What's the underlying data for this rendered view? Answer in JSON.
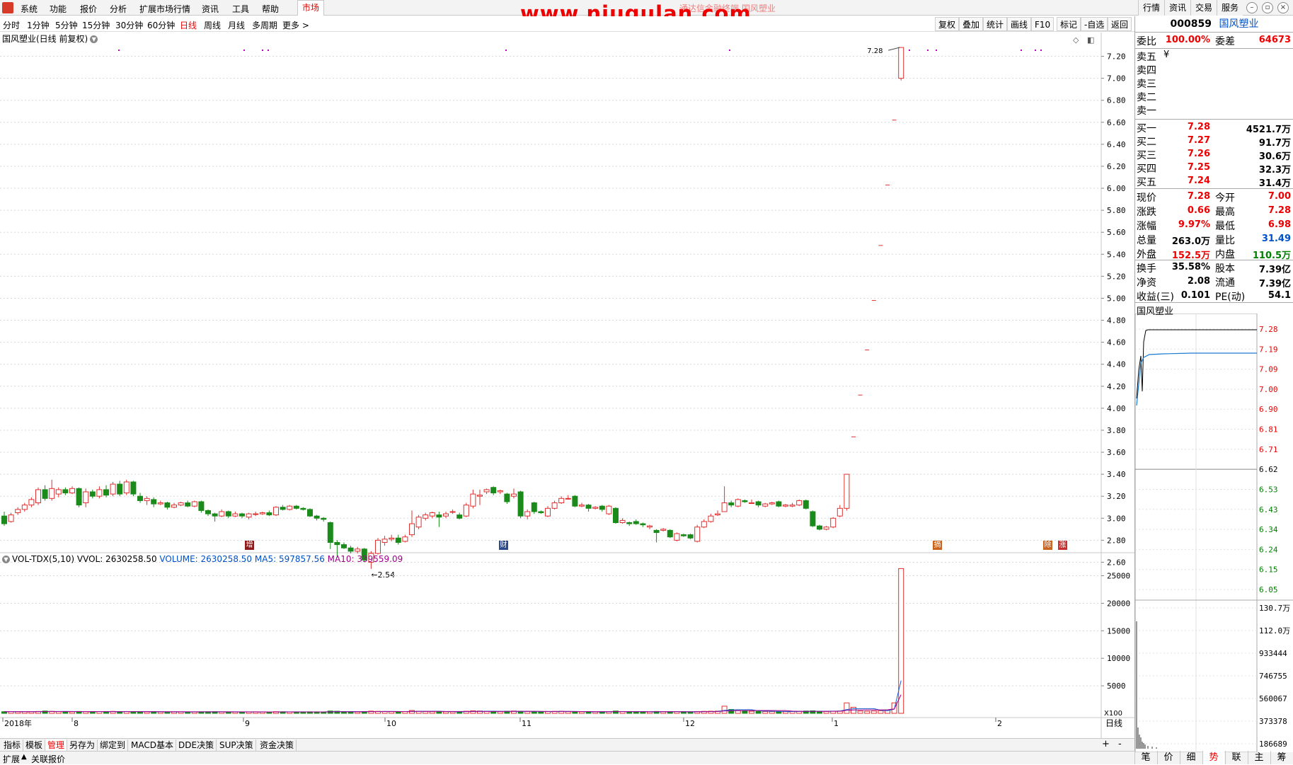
{
  "menubar": {
    "items": [
      "系统",
      "功能",
      "报价",
      "分析",
      "扩展市场行情",
      "资讯",
      "工具",
      "帮助"
    ],
    "market": "市场",
    "watermark": "www.niugulan.com",
    "watermark_under": "通达信金融终端 国风塑业",
    "right_buttons": [
      "行情",
      "资讯",
      "交易",
      "服务"
    ]
  },
  "periods": [
    "分时",
    "1分钟",
    "5分钟",
    "15分钟",
    "30分钟",
    "60分钟",
    "日线",
    "周线",
    "月线",
    "多周期",
    "更多 >"
  ],
  "active_period": "日线",
  "tools": [
    "复权",
    "叠加",
    "统计",
    "画线",
    "F10",
    "标记",
    "-自选",
    "返回"
  ],
  "chart_title": "国风塑业(日线 前复权)",
  "vol_title": {
    "name": "VOL-TDX(5,10)",
    "vvol": "VVOL: 2630258.50",
    "volume": "VOLUME: 2630258.50",
    "ma5": "MA5: 597857.56",
    "ma10": "MA10: 339559.09"
  },
  "price_axis": [
    "7.20",
    "7.00",
    "6.80",
    "6.60",
    "6.40",
    "6.20",
    "6.00",
    "5.80",
    "5.60",
    "5.40",
    "5.20",
    "5.00",
    "4.80",
    "4.60",
    "4.40",
    "4.20",
    "4.00",
    "3.80",
    "3.60",
    "3.40",
    "3.20",
    "3.00",
    "2.80",
    "2.60"
  ],
  "vol_axis": [
    "25000",
    "20000",
    "15000",
    "10000",
    "5000"
  ],
  "vol_unit": "X100",
  "date_axis": [
    {
      "label": "2018年",
      "x": 4
    },
    {
      "label": "8",
      "x": 102
    },
    {
      "label": "9",
      "x": 344
    },
    {
      "label": "10",
      "x": 544
    },
    {
      "label": "11",
      "x": 735
    },
    {
      "label": "12",
      "x": 966
    },
    {
      "label": "1",
      "x": 1176
    },
    {
      "label": "2",
      "x": 1407
    }
  ],
  "date_mode": "日线",
  "annotations": {
    "high": "7.28",
    "low": "2.54"
  },
  "markers": [
    "增",
    "财",
    "摘",
    "除",
    "涨"
  ],
  "quote": {
    "code": "000859",
    "name": "国风塑业",
    "weibi_label": "委比",
    "weibi": "100.00%",
    "weicha_label": "委差",
    "weicha": "64673",
    "sell": [
      {
        "label": "卖五",
        "price": "¥",
        "vol": ""
      },
      {
        "label": "卖四",
        "price": "",
        "vol": ""
      },
      {
        "label": "卖三",
        "price": "",
        "vol": ""
      },
      {
        "label": "卖二",
        "price": "",
        "vol": ""
      },
      {
        "label": "卖一",
        "price": "",
        "vol": ""
      }
    ],
    "buy": [
      {
        "label": "买一",
        "price": "7.28",
        "vol": "4521.7万"
      },
      {
        "label": "买二",
        "price": "7.27",
        "vol": "91.7万"
      },
      {
        "label": "买三",
        "price": "7.26",
        "vol": "30.6万"
      },
      {
        "label": "买四",
        "price": "7.25",
        "vol": "32.3万"
      },
      {
        "label": "买五",
        "price": "7.24",
        "vol": "31.4万"
      }
    ],
    "stats": [
      {
        "l": "现价",
        "v": "7.28",
        "vc": "red",
        "l2": "今开",
        "v2": "7.00",
        "v2c": "red"
      },
      {
        "l": "涨跌",
        "v": "0.66",
        "vc": "red",
        "l2": "最高",
        "v2": "7.28",
        "v2c": "red"
      },
      {
        "l": "涨幅",
        "v": "9.97%",
        "vc": "red",
        "l2": "最低",
        "v2": "6.98",
        "v2c": "red"
      },
      {
        "l": "总量",
        "v": "263.0万",
        "vc": "black",
        "l2": "量比",
        "v2": "31.49",
        "v2c": "blue"
      },
      {
        "l": "外盘",
        "v": "152.5万",
        "vc": "red",
        "l2": "内盘",
        "v2": "110.5万",
        "v2c": "green"
      },
      {
        "l": "换手",
        "v": "35.58%",
        "vc": "black",
        "l2": "股本",
        "v2": "7.39亿",
        "v2c": "black"
      },
      {
        "l": "净资",
        "v": "2.08",
        "vc": "black",
        "l2": "流通",
        "v2": "7.39亿",
        "v2c": "black"
      },
      {
        "l": "收益(三)",
        "v": "0.101",
        "vc": "black",
        "l2": "PE(动)",
        "v2": "54.1",
        "v2c": "black"
      }
    ],
    "mini_title": "国风塑业",
    "mini_price_axis": [
      "7.28",
      "7.19",
      "7.09",
      "7.00",
      "6.90",
      "6.81",
      "6.71",
      "6.62",
      "6.53",
      "6.43",
      "6.34",
      "6.24",
      "6.15",
      "6.05"
    ],
    "mini_vol_axis": [
      "130.7万",
      "112.0万",
      "933444",
      "746755",
      "560067",
      "373378",
      "186689"
    ]
  },
  "bottom_tabs": [
    "指标",
    "模板",
    "管理",
    "另存为",
    "绑定到",
    "MACD基本",
    "DDE决策",
    "SUP决策",
    "资金决策"
  ],
  "active_bottom_tab": "管理",
  "date_label": "日线",
  "status_tabs": [
    "扩展",
    "关联报价"
  ],
  "right_tabs": [
    "笔",
    "价",
    "细",
    "势",
    "联",
    "主",
    "筹"
  ],
  "active_right_tab": "势",
  "chart_data": {
    "type": "candlestick",
    "ylim": [
      2.5,
      7.3
    ],
    "candles": [
      [
        3.02,
        2.95,
        3.06,
        2.93
      ],
      [
        2.97,
        3.03,
        3.05,
        2.96
      ],
      [
        3.05,
        3.08,
        3.1,
        3.03
      ],
      [
        3.08,
        3.12,
        3.14,
        3.06
      ],
      [
        3.12,
        3.17,
        3.19,
        3.1
      ],
      [
        3.14,
        3.26,
        3.28,
        3.12
      ],
      [
        3.26,
        3.18,
        3.3,
        3.16
      ],
      [
        3.18,
        3.27,
        3.35,
        3.16
      ],
      [
        3.22,
        3.26,
        3.28,
        3.19
      ],
      [
        3.26,
        3.23,
        3.28,
        3.21
      ],
      [
        3.23,
        3.27,
        3.29,
        3.22
      ],
      [
        3.27,
        3.12,
        3.28,
        3.1
      ],
      [
        3.14,
        3.24,
        3.27,
        3.1
      ],
      [
        3.24,
        3.2,
        3.26,
        3.18
      ],
      [
        3.2,
        3.26,
        3.29,
        3.18
      ],
      [
        3.26,
        3.21,
        3.3,
        3.19
      ],
      [
        3.22,
        3.31,
        3.33,
        3.2
      ],
      [
        3.31,
        3.22,
        3.34,
        3.2
      ],
      [
        3.23,
        3.33,
        3.35,
        3.21
      ],
      [
        3.33,
        3.22,
        3.34,
        3.2
      ],
      [
        3.2,
        3.16,
        3.23,
        3.14
      ],
      [
        3.16,
        3.18,
        3.2,
        3.12
      ],
      [
        3.17,
        3.13,
        3.19,
        3.1
      ],
      [
        3.13,
        3.14,
        3.16,
        3.12
      ],
      [
        3.14,
        3.1,
        3.15,
        3.08
      ],
      [
        3.1,
        3.12,
        3.14,
        3.09
      ],
      [
        3.12,
        3.14,
        3.15,
        3.11
      ],
      [
        3.14,
        3.11,
        3.16,
        3.1
      ],
      [
        3.11,
        3.15,
        3.16,
        3.1
      ],
      [
        3.15,
        3.07,
        3.16,
        3.05
      ],
      [
        3.07,
        3.04,
        3.08,
        3.02
      ],
      [
        3.04,
        3.02,
        3.05,
        2.97
      ],
      [
        3.02,
        3.06,
        3.08,
        3.01
      ],
      [
        3.06,
        3.02,
        3.07,
        3.0
      ],
      [
        3.02,
        3.04,
        3.06,
        3.01
      ],
      [
        3.04,
        3.02,
        3.05,
        3.0
      ],
      [
        3.01,
        3.04,
        3.05,
        2.99
      ],
      [
        3.04,
        3.04,
        3.06,
        3.02
      ],
      [
        3.04,
        3.05,
        3.06,
        3.03
      ],
      [
        3.05,
        3.03,
        3.07,
        3.02
      ],
      [
        3.03,
        3.1,
        3.11,
        3.02
      ],
      [
        3.1,
        3.08,
        3.12,
        3.07
      ],
      [
        3.08,
        3.11,
        3.12,
        3.07
      ],
      [
        3.11,
        3.09,
        3.12,
        3.08
      ],
      [
        3.09,
        3.08,
        3.1,
        3.07
      ],
      [
        3.08,
        3.02,
        3.09,
        3.01
      ],
      [
        3.02,
        3.0,
        3.03,
        2.98
      ],
      [
        3.0,
        2.99,
        3.01,
        2.97
      ],
      [
        2.96,
        2.78,
        2.97,
        2.72
      ],
      [
        2.78,
        2.76,
        2.8,
        2.64
      ],
      [
        2.76,
        2.73,
        2.78,
        2.72
      ],
      [
        2.73,
        2.7,
        2.75,
        2.68
      ],
      [
        2.7,
        2.72,
        2.74,
        2.68
      ],
      [
        2.72,
        2.62,
        2.73,
        2.6
      ],
      [
        2.6,
        2.68,
        2.7,
        2.54
      ],
      [
        2.68,
        2.8,
        2.82,
        2.67
      ],
      [
        2.78,
        2.81,
        2.84,
        2.75
      ],
      [
        2.81,
        2.82,
        2.85,
        2.79
      ],
      [
        2.82,
        2.78,
        2.85,
        2.76
      ],
      [
        2.79,
        2.83,
        2.85,
        2.78
      ],
      [
        2.85,
        2.95,
        3.07,
        2.83
      ],
      [
        2.92,
        3.01,
        3.03,
        2.9
      ],
      [
        3.0,
        3.03,
        3.05,
        2.98
      ],
      [
        3.02,
        3.05,
        3.06,
        3.0
      ],
      [
        3.03,
        3.01,
        3.06,
        2.92
      ],
      [
        3.02,
        3.04,
        3.06,
        3.0
      ],
      [
        3.06,
        3.06,
        3.08,
        3.04
      ],
      [
        3.03,
        3.0,
        3.05,
        2.99
      ],
      [
        3.02,
        3.12,
        3.14,
        3.01
      ],
      [
        3.11,
        3.22,
        3.26,
        3.09
      ],
      [
        3.2,
        3.21,
        3.26,
        3.12
      ],
      [
        3.24,
        3.26,
        3.27,
        3.22
      ],
      [
        3.28,
        3.23,
        3.29,
        3.21
      ],
      [
        3.24,
        3.25,
        3.26,
        3.22
      ],
      [
        3.22,
        3.15,
        3.23,
        3.13
      ],
      [
        3.2,
        3.22,
        3.27,
        3.18
      ],
      [
        3.24,
        3.02,
        3.25,
        3.0
      ],
      [
        3.02,
        3.06,
        3.08,
        2.99
      ],
      [
        3.14,
        3.06,
        3.15,
        3.04
      ],
      [
        3.06,
        3.05,
        3.07,
        3.04
      ],
      [
        3.02,
        3.09,
        3.11,
        3.01
      ],
      [
        3.09,
        3.14,
        3.16,
        3.08
      ],
      [
        3.14,
        3.18,
        3.2,
        3.13
      ],
      [
        3.18,
        3.18,
        3.21,
        3.17
      ],
      [
        3.2,
        3.11,
        3.21,
        3.1
      ],
      [
        3.11,
        3.12,
        3.14,
        3.1
      ],
      [
        3.12,
        3.09,
        3.13,
        3.06
      ],
      [
        3.09,
        3.1,
        3.11,
        3.08
      ],
      [
        3.11,
        3.08,
        3.12,
        3.06
      ],
      [
        3.04,
        3.11,
        3.12,
        3.03
      ],
      [
        3.09,
        2.96,
        3.1,
        2.95
      ],
      [
        2.96,
        2.98,
        3.0,
        2.95
      ],
      [
        2.96,
        2.95,
        2.97,
        2.93
      ],
      [
        2.97,
        2.95,
        2.99,
        2.94
      ],
      [
        2.95,
        2.94,
        2.96,
        2.92
      ],
      [
        2.92,
        2.93,
        2.94,
        2.9
      ],
      [
        2.89,
        2.87,
        2.9,
        2.78
      ],
      [
        2.89,
        2.9,
        2.91,
        2.88
      ],
      [
        2.89,
        2.83,
        2.9,
        2.82
      ],
      [
        2.8,
        2.86,
        2.87,
        2.79
      ],
      [
        2.85,
        2.84,
        2.86,
        2.83
      ],
      [
        2.85,
        2.82,
        2.86,
        2.81
      ],
      [
        2.79,
        2.92,
        2.94,
        2.78
      ],
      [
        2.92,
        2.97,
        2.99,
        2.91
      ],
      [
        2.97,
        3.02,
        3.04,
        2.96
      ],
      [
        3.03,
        3.04,
        3.07,
        3.02
      ],
      [
        3.06,
        3.14,
        3.29,
        3.06
      ],
      [
        3.14,
        3.12,
        3.16,
        3.1
      ],
      [
        3.11,
        3.17,
        3.18,
        3.1
      ],
      [
        3.16,
        3.15,
        3.17,
        3.14
      ],
      [
        3.14,
        3.14,
        3.17,
        3.13
      ],
      [
        3.15,
        3.12,
        3.16,
        3.1
      ],
      [
        3.11,
        3.13,
        3.14,
        3.1
      ],
      [
        3.13,
        3.14,
        3.15,
        3.12
      ],
      [
        3.15,
        3.11,
        3.16,
        3.1
      ],
      [
        3.11,
        3.12,
        3.13,
        3.1
      ],
      [
        3.11,
        3.12,
        3.14,
        3.1
      ],
      [
        3.12,
        3.16,
        3.17,
        3.11
      ],
      [
        3.16,
        3.09,
        3.17,
        3.08
      ],
      [
        3.06,
        2.93,
        3.07,
        2.92
      ],
      [
        2.93,
        2.9,
        2.94,
        2.89
      ],
      [
        2.9,
        2.92,
        2.93,
        2.89
      ],
      [
        2.92,
        3.0,
        3.01,
        2.91
      ],
      [
        3.02,
        3.09,
        3.12,
        3.01
      ],
      [
        3.09,
        3.4,
        3.4,
        3.07
      ],
      [
        3.74,
        3.74,
        3.74,
        3.74
      ],
      [
        4.12,
        4.12,
        4.12,
        4.12
      ],
      [
        4.53,
        4.53,
        4.53,
        4.53
      ],
      [
        4.98,
        4.98,
        4.98,
        4.98
      ],
      [
        5.48,
        5.48,
        5.48,
        5.48
      ],
      [
        6.03,
        6.03,
        6.03,
        6.03
      ],
      [
        6.62,
        6.62,
        6.62,
        6.62
      ],
      [
        7.0,
        7.28,
        7.28,
        6.98
      ]
    ],
    "volume": {
      "unit": "X100",
      "ylim": [
        0,
        27000
      ],
      "values": [
        300,
        320,
        280,
        300,
        290,
        340,
        420,
        360,
        300,
        310,
        280,
        340,
        300,
        290,
        320,
        280,
        350,
        300,
        330,
        310,
        290,
        280,
        300,
        260,
        270,
        280,
        260,
        250,
        270,
        280,
        290,
        300,
        270,
        260,
        250,
        240,
        260,
        270,
        250,
        240,
        300,
        280,
        260,
        250,
        240,
        280,
        270,
        260,
        420,
        380,
        300,
        280,
        260,
        320,
        400,
        360,
        330,
        300,
        290,
        310,
        520,
        380,
        330,
        300,
        340,
        290,
        280,
        270,
        380,
        460,
        420,
        360,
        340,
        300,
        380,
        420,
        360,
        330,
        310,
        300,
        340,
        360,
        380,
        300,
        290,
        280,
        270,
        260,
        280,
        300,
        420,
        330,
        300,
        280,
        260,
        270,
        340,
        300,
        290,
        310,
        280,
        270,
        330,
        360,
        380,
        400,
        1300,
        700,
        500,
        420,
        380,
        360,
        340,
        330,
        320,
        310,
        330,
        360,
        420,
        460,
        380,
        340,
        380,
        420,
        1900,
        1100,
        420,
        380,
        420,
        480,
        620,
        1900,
        26303
      ],
      "ma5_last": 5978.57,
      "ma10_last": 3395.59
    }
  }
}
